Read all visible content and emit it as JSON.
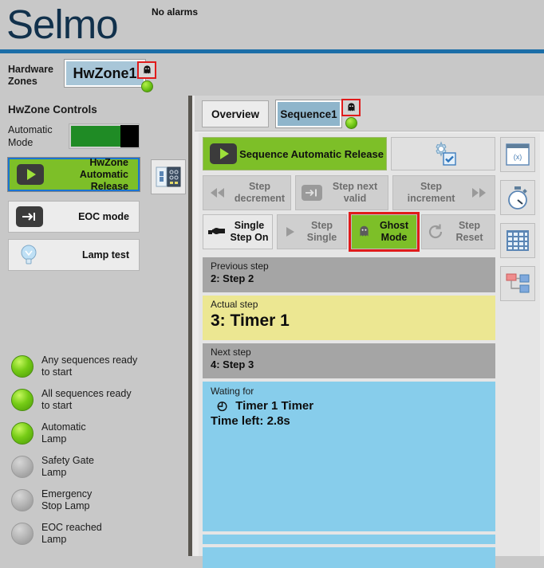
{
  "header": {
    "logo": "Selmo",
    "alarm_status": "No alarms",
    "rule_color": "#1c6ea8",
    "logo_color": "#11314c"
  },
  "sidebar": {
    "hardware_zones_label": "Hardware\nZones",
    "hardware_zones_label_line1": "Hardware",
    "hardware_zones_label_line2": "Zones",
    "zone_tab": {
      "label": "HwZone1",
      "ghost_icon": "ghost-icon",
      "status": "ready",
      "status_color": "#6cc415",
      "highlight_color": "#e01b1b"
    },
    "controls_title": "HwZone Controls",
    "automatic_mode": {
      "label_line1": "Automatic",
      "label_line2": "Mode",
      "state": "on",
      "bar_color": "#1f8b25"
    },
    "io_button": {
      "icon": "io-module-icon"
    },
    "buttons": [
      {
        "label_line1": "HwZone",
        "label_line2": "Automatic Release",
        "icon": "play-icon",
        "state": "active",
        "color": "#7dbf28"
      },
      {
        "label_line1": "EOC mode",
        "label_line2": "",
        "icon": "step-end-icon",
        "state": "normal"
      },
      {
        "label_line1": "Lamp test",
        "label_line2": "",
        "icon": "lightbulb-icon",
        "state": "normal"
      }
    ],
    "lamps": [
      {
        "line1": "Any sequences ready",
        "line2": "to start",
        "state": "on"
      },
      {
        "line1": "All sequences ready",
        "line2": "to start",
        "state": "on"
      },
      {
        "line1": "Automatic",
        "line2": "Lamp",
        "state": "on"
      },
      {
        "line1": "Safety Gate",
        "line2": "Lamp",
        "state": "off"
      },
      {
        "line1": "Emergency",
        "line2": "Stop Lamp",
        "state": "off"
      },
      {
        "line1": "EOC reached",
        "line2": "Lamp",
        "state": "off"
      }
    ]
  },
  "main": {
    "tabs": [
      {
        "label": "Overview",
        "selected": false
      },
      {
        "label": "Sequence1",
        "selected": true,
        "ghost_icon": "ghost-icon",
        "status_color": "#6cc415"
      }
    ],
    "sequence_release_button": {
      "label": "Sequence Automatic Release",
      "icon": "play-icon",
      "state": "active",
      "color": "#7dbf28"
    },
    "settings_button": {
      "icon": "gear-check-icon"
    },
    "step_buttons": [
      {
        "label_line1": "Step",
        "label_line2": "decrement",
        "icon": "rewind-icon",
        "icon_side": "left",
        "state": "disabled"
      },
      {
        "label_line1": "Step next",
        "label_line2": "valid",
        "icon": "step-end-icon",
        "icon_side": "left",
        "state": "disabled"
      },
      {
        "label_line1": "Step",
        "label_line2": "increment",
        "icon": "fast-forward-icon",
        "icon_side": "right",
        "state": "disabled"
      },
      {
        "label_line1": "Single",
        "label_line2": "Step On",
        "icon": "pointing-hand-icon",
        "icon_side": "left",
        "state": "enabled"
      },
      {
        "label_line1": "Step",
        "label_line2": "Single",
        "icon": "play-triangle-icon",
        "icon_side": "left",
        "state": "disabled"
      },
      {
        "label_line1": "Ghost",
        "label_line2": "Mode",
        "icon": "ghost-icon",
        "icon_side": "left",
        "state": "active",
        "highlighted": true
      },
      {
        "label_line1": "Step",
        "label_line2": "Reset",
        "icon": "refresh-icon",
        "icon_side": "left",
        "state": "disabled"
      }
    ],
    "side_icons": [
      {
        "name": "variables-window-icon",
        "glyph": "(x)"
      },
      {
        "name": "stopwatch-icon"
      },
      {
        "name": "table-grid-icon"
      },
      {
        "name": "hierarchy-tree-icon"
      }
    ],
    "steps": {
      "previous": {
        "title": "Previous step",
        "value": "2: Step 2"
      },
      "actual": {
        "title": "Actual step",
        "value": "3: Timer 1"
      },
      "next": {
        "title": "Next step",
        "value": "4: Step 3"
      },
      "waiting": {
        "title": "Wating for",
        "item": "Timer 1 Timer",
        "item_icon": "timer-icon",
        "time_left": "Time left: 2.8s"
      }
    }
  }
}
